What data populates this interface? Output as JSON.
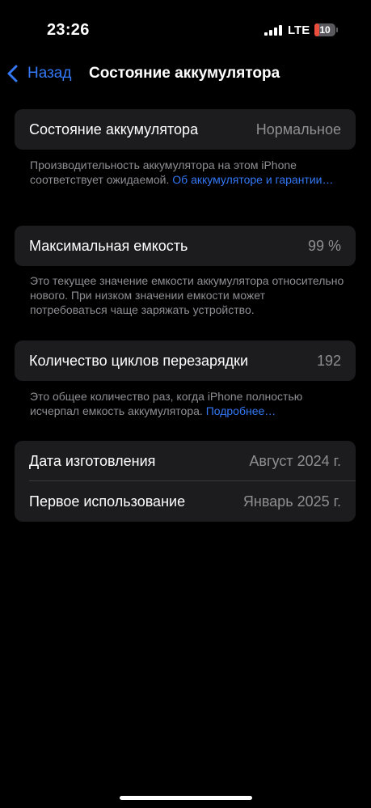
{
  "status_bar": {
    "time": "23:26",
    "network": "LTE",
    "battery_level": "10"
  },
  "nav": {
    "back_label": "Назад",
    "title": "Состояние аккумулятора"
  },
  "health": {
    "label": "Состояние аккумулятора",
    "value": "Нормальное",
    "footnote_text": "Производительность аккумулятора на этом iPhone соответствует ожидаемой. ",
    "footnote_link": "Об аккумуляторе и гарантии…"
  },
  "capacity": {
    "label": "Максимальная емкость",
    "value": "99 %",
    "footnote_text": "Это текущее значение емкости аккумулятора относительно нового. При низком значении емкости может потребоваться чаще заряжать устройство."
  },
  "cycles": {
    "label": "Количество циклов перезарядки",
    "value": "192",
    "footnote_text": "Это общее количество раз, когда iPhone полностью исчерпал емкость аккумулятора. ",
    "footnote_link": "Подробнее…"
  },
  "dates": {
    "manufacture_label": "Дата изготовления",
    "manufacture_value": "Август 2024 г.",
    "first_use_label": "Первое использование",
    "first_use_value": "Январь 2025 г."
  },
  "colors": {
    "background": "#000000",
    "cell": "#1c1c1e",
    "accent": "#3478f6",
    "secondary_text": "#8e8e93",
    "battery_low": "#eb4e3d"
  },
  "icons": {
    "back": "chevron-left-icon",
    "signal": "cellular-signal-icon",
    "battery": "battery-icon"
  }
}
